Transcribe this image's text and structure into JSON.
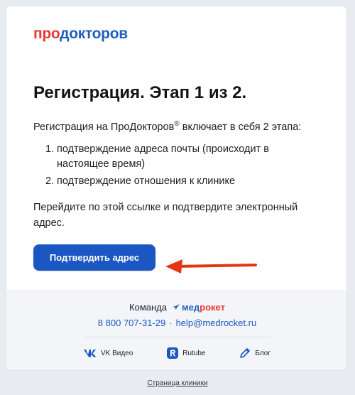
{
  "logo": {
    "part1": "про",
    "part2": "докторов"
  },
  "title": "Регистрация. Этап 1 из 2.",
  "intro": {
    "before": "Регистрация на ПроДокторов",
    "sup": "®",
    "after": " включает в себя 2 этапа:"
  },
  "steps": [
    {
      "num": "1.",
      "text": "подтверждение адреса почты (происходит в настоящее время)"
    },
    {
      "num": "2.",
      "text": "подтверждение отношения к клинике"
    }
  ],
  "outro": "Перейдите по этой ссылке и подтвердите электронный адрес.",
  "button_label": "Подтвердить адрес",
  "footer": {
    "team_label": "Команда",
    "brand_part1": "мед",
    "brand_part2": "рокет",
    "phone": "8 800 707-31-29",
    "separator": "·",
    "email": "help@medrocket.ru",
    "socials": [
      {
        "label": "VK Видео",
        "icon": "vk-video-icon"
      },
      {
        "label": "Rutube",
        "icon": "rutube-icon"
      },
      {
        "label": "Блог",
        "icon": "pen-icon"
      }
    ]
  },
  "bottom_link": "Страница клиники",
  "colors": {
    "accent": "#1a57c2",
    "brand_red": "#e53935",
    "arrow": "#e53512",
    "footer_bg": "#f3f5f8"
  }
}
